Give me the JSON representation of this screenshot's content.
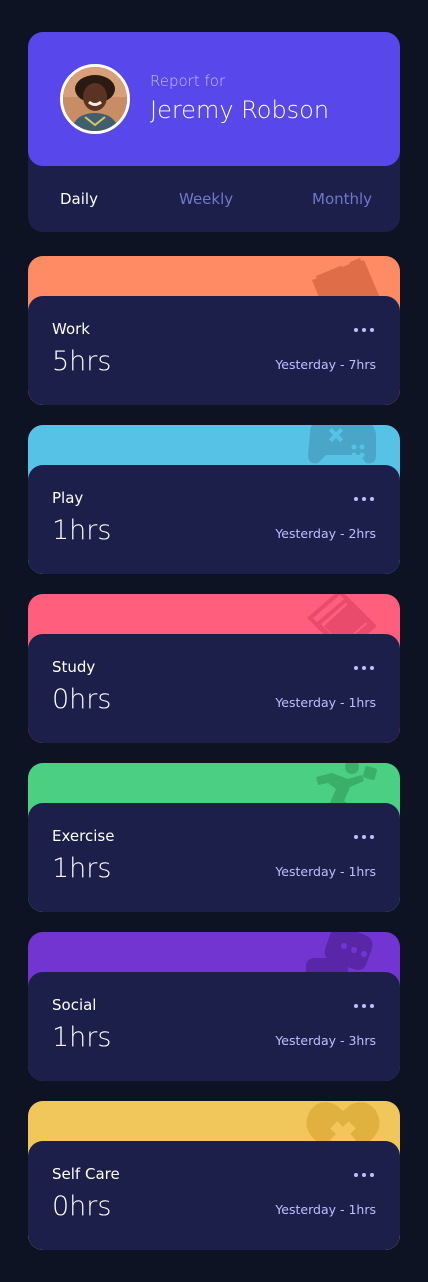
{
  "profile": {
    "report_for": "Report for",
    "name": "Jeremy Robson"
  },
  "periods": [
    {
      "label": "Daily",
      "active": true
    },
    {
      "label": "Weekly",
      "active": false
    },
    {
      "label": "Monthly",
      "active": false
    }
  ],
  "activities": [
    {
      "title": "Work",
      "hours": "5hrs",
      "previous": "Yesterday - 7hrs",
      "color": "#ff8b64",
      "icon": "briefcase-icon"
    },
    {
      "title": "Play",
      "hours": "1hrs",
      "previous": "Yesterday - 2hrs",
      "color": "#55c2e6",
      "icon": "gamepad-icon"
    },
    {
      "title": "Study",
      "hours": "0hrs",
      "previous": "Yesterday - 1hrs",
      "color": "#ff5e7d",
      "icon": "book-icon"
    },
    {
      "title": "Exercise",
      "hours": "1hrs",
      "previous": "Yesterday - 1hrs",
      "color": "#4bcf82",
      "icon": "running-icon"
    },
    {
      "title": "Social",
      "hours": "1hrs",
      "previous": "Yesterday - 3hrs",
      "color": "#7335d2",
      "icon": "chat-icon"
    },
    {
      "title": "Self Care",
      "hours": "0hrs",
      "previous": "Yesterday - 1hrs",
      "color": "#f1c75b",
      "icon": "heart-icon"
    }
  ],
  "colors": {
    "background": "#0e1323",
    "card": "#1c1f4a",
    "accent": "#5847eb",
    "muted_text": "#bbc0ff"
  }
}
